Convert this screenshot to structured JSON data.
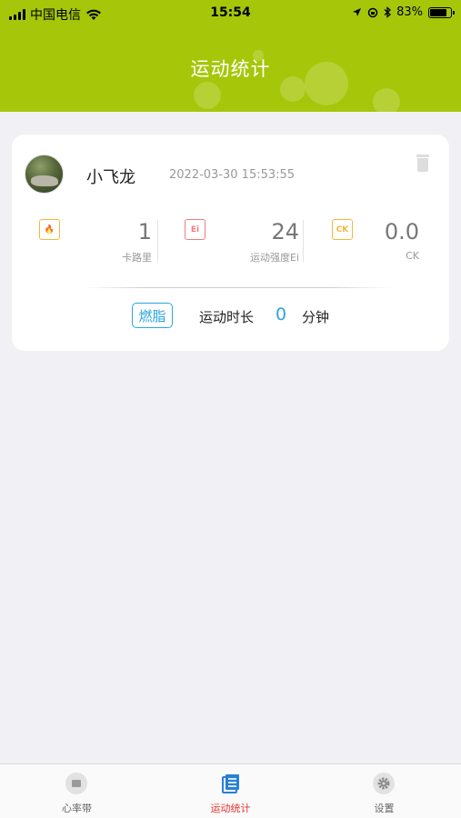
{
  "status_bar": {
    "carrier": "中国电信",
    "time": "15:54",
    "battery": "83%",
    "battery_level": 0.83
  },
  "header": {
    "title": "运动统计",
    "background_color": "#a6c60a"
  },
  "record": {
    "username": "小飞龙",
    "datetime": "2022-03-30 15:53:55",
    "stats": [
      {
        "icon_text": "🔥",
        "icon_name": "flame-icon",
        "value": "1",
        "label": "卡路里",
        "color": "#f5b73a"
      },
      {
        "icon_text": "Ei",
        "icon_name": "ei-icon",
        "value": "24",
        "label": "运动强度Ei",
        "color": "#f07d7d"
      },
      {
        "icon_text": "CK",
        "icon_name": "ck-icon",
        "value": "0.0",
        "label": "CK",
        "color": "#f5b73a"
      }
    ],
    "mode_badge": "燃脂",
    "duration_label": "运动时长",
    "duration_value": "0",
    "duration_unit": "分钟",
    "accent_color": "#2aa5df"
  },
  "tabbar": {
    "tabs": [
      {
        "label": "心率带",
        "icon": "heart-band-icon",
        "active": false
      },
      {
        "label": "运动统计",
        "icon": "stats-icon",
        "active": true
      },
      {
        "label": "设置",
        "icon": "gear-icon",
        "active": false
      }
    ],
    "active_color": "#e8342e",
    "inactive_color": "#666666"
  }
}
